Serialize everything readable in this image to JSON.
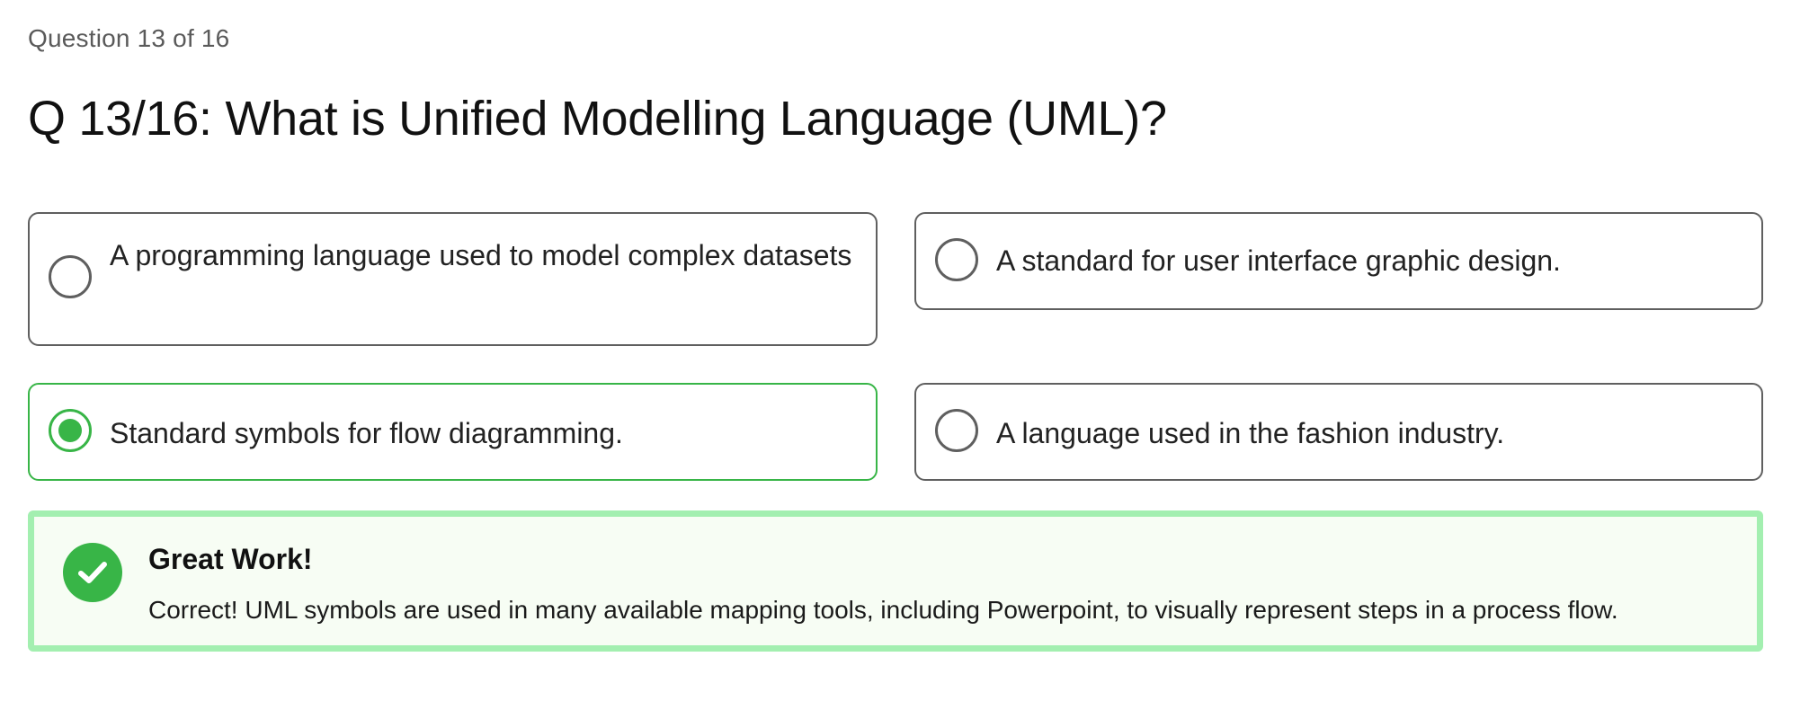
{
  "progress_text": "Question 13 of 16",
  "question": {
    "title": "Q 13/16: What is Unified Modelling Language (UML)?"
  },
  "options": [
    {
      "label": "A programming language used to model complex datasets",
      "selected": false
    },
    {
      "label": "A standard for user interface graphic design.",
      "selected": false
    },
    {
      "label": "Standard symbols for flow diagramming.",
      "selected": true
    },
    {
      "label": "A language used in the fashion industry.",
      "selected": false
    }
  ],
  "feedback": {
    "status_icon": "check-circle-icon",
    "title": "Great Work!",
    "message": "Correct! UML symbols are used in many available mapping tools, including Powerpoint, to visually represent steps in a process flow."
  },
  "colors": {
    "correct_green": "#38b547",
    "feedback_border": "#a3efb0",
    "feedback_background": "#f7fdf4",
    "option_border": "#5f5f5f"
  }
}
